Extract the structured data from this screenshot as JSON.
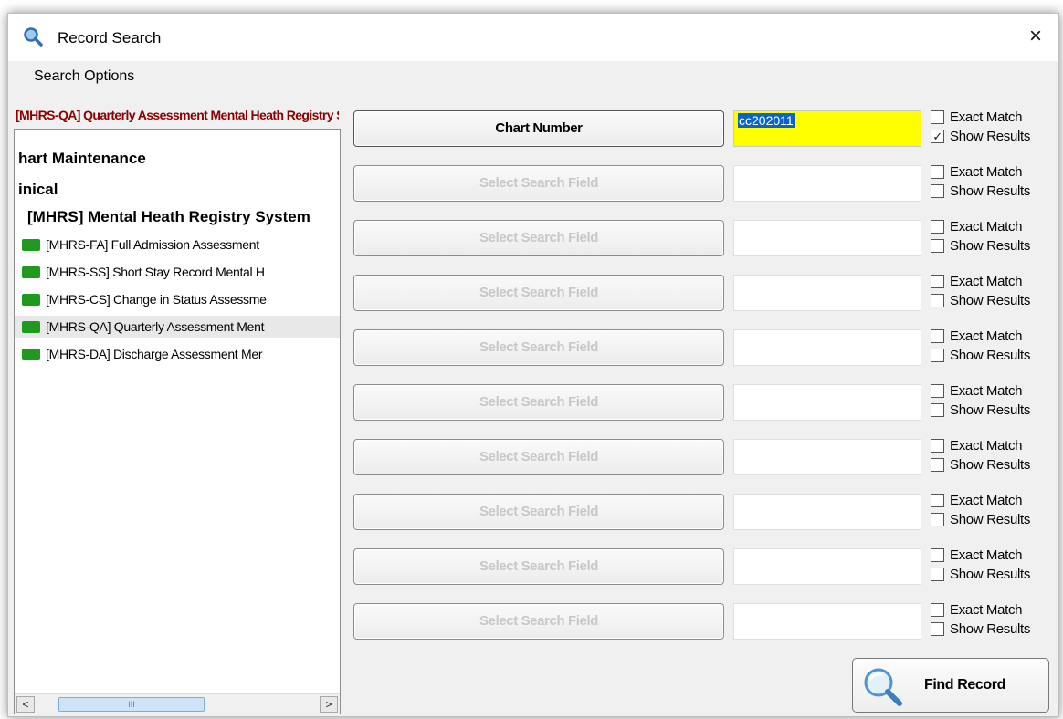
{
  "window": {
    "title": "Record Search",
    "close_glyph": "×",
    "title_icon": "magnifier-icon"
  },
  "menu": {
    "search_options": "Search Options"
  },
  "left_panel": {
    "header": "[MHRS-QA] Quarterly Assessment Mental Heath Registry System",
    "tree": [
      {
        "label": "hart Maintenance",
        "level": 0
      },
      {
        "label": "inical",
        "level": 0
      },
      {
        "label": "[MHRS] Mental Heath Registry System",
        "level": 1
      },
      {
        "label": "[MHRS-FA] Full Admission Assessment",
        "level": 2,
        "selected": false
      },
      {
        "label": "[MHRS-SS] Short Stay Record Mental H",
        "level": 2,
        "selected": false
      },
      {
        "label": "[MHRS-CS] Change in Status Assessme",
        "level": 2,
        "selected": false
      },
      {
        "label": "[MHRS-QA] Quarterly Assessment Ment",
        "level": 2,
        "selected": true
      },
      {
        "label": "[MHRS-DA] Discharge Assessment Mer",
        "level": 2,
        "selected": false
      }
    ],
    "scroll_left": "<",
    "scroll_right": ">",
    "scroll_thumb_grip": "III"
  },
  "search_rows": [
    {
      "field": "Chart Number",
      "active": true,
      "value": "cc202011",
      "exact_label": "Exact Match",
      "exact": false,
      "show_label": "Show Results",
      "show": true
    },
    {
      "field": "Select Search Field",
      "active": false,
      "value": "",
      "exact_label": "Exact Match",
      "exact": false,
      "show_label": "Show Results",
      "show": false
    },
    {
      "field": "Select Search Field",
      "active": false,
      "value": "",
      "exact_label": "Exact Match",
      "exact": false,
      "show_label": "Show Results",
      "show": false
    },
    {
      "field": "Select Search Field",
      "active": false,
      "value": "",
      "exact_label": "Exact Match",
      "exact": false,
      "show_label": "Show Results",
      "show": false
    },
    {
      "field": "Select Search Field",
      "active": false,
      "value": "",
      "exact_label": "Exact Match",
      "exact": false,
      "show_label": "Show Results",
      "show": false
    },
    {
      "field": "Select Search Field",
      "active": false,
      "value": "",
      "exact_label": "Exact Match",
      "exact": false,
      "show_label": "Show Results",
      "show": false
    },
    {
      "field": "Select Search Field",
      "active": false,
      "value": "",
      "exact_label": "Exact Match",
      "exact": false,
      "show_label": "Show Results",
      "show": false
    },
    {
      "field": "Select Search Field",
      "active": false,
      "value": "",
      "exact_label": "Exact Match",
      "exact": false,
      "show_label": "Show Results",
      "show": false
    },
    {
      "field": "Select Search Field",
      "active": false,
      "value": "",
      "exact_label": "Exact Match",
      "exact": false,
      "show_label": "Show Results",
      "show": false
    },
    {
      "field": "Select Search Field",
      "active": false,
      "value": "",
      "exact_label": "Exact Match",
      "exact": false,
      "show_label": "Show Results",
      "show": false
    }
  ],
  "find_button": {
    "label": "Find Record",
    "icon": "magnifier-icon"
  },
  "colors": {
    "header_text": "#8b0000",
    "input_highlight": "#ffff00",
    "selection": "#0a64c8",
    "folder": "#1f9a1f"
  }
}
